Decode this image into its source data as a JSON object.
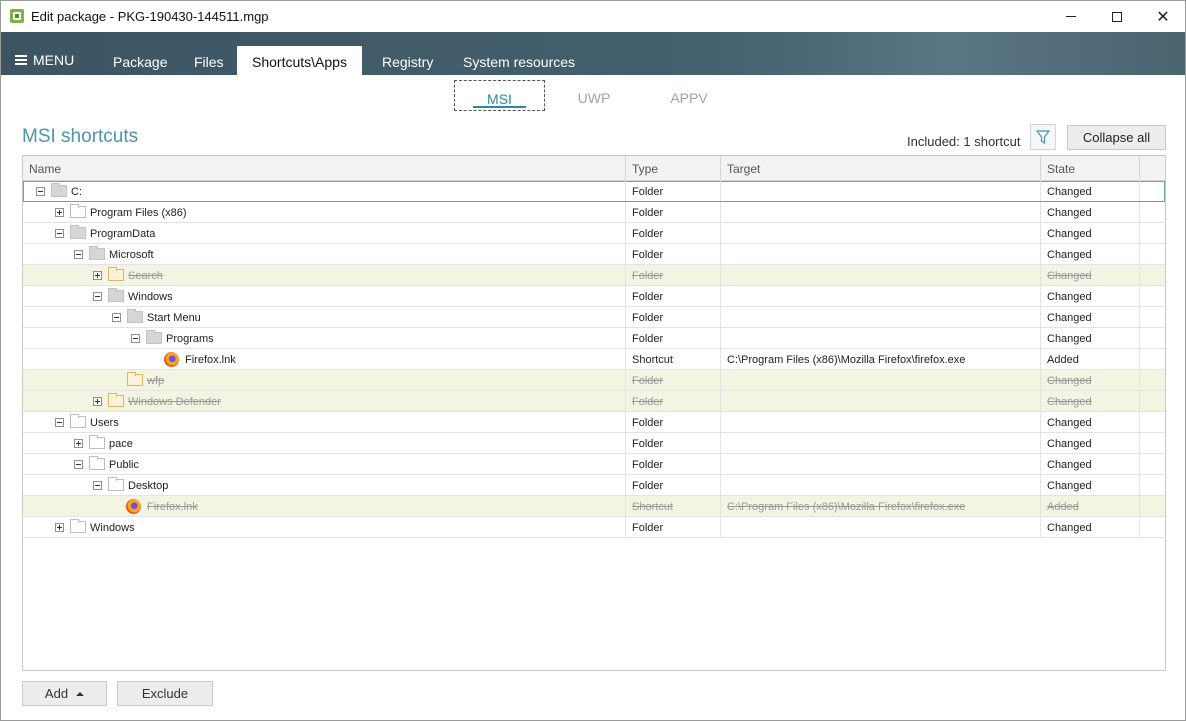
{
  "window": {
    "title": "Edit package - PKG-190430-144511.mgp"
  },
  "menu": {
    "label": "MENU"
  },
  "main_tabs": [
    {
      "label": "Package"
    },
    {
      "label": "Files"
    },
    {
      "label": "Shortcuts\\Apps"
    },
    {
      "label": "Registry"
    },
    {
      "label": "System resources"
    }
  ],
  "sub_tabs": [
    {
      "label": "MSI"
    },
    {
      "label": "UWP"
    },
    {
      "label": "APPV"
    }
  ],
  "section": {
    "title": "MSI shortcuts",
    "included": "Included: 1 shortcut",
    "collapse_label": "Collapse all"
  },
  "columns": [
    "Name",
    "Type",
    "Target",
    "State"
  ],
  "rows": [
    {
      "name": "C:",
      "type": "Folder",
      "target": "",
      "state": "Changed"
    },
    {
      "name": "Program Files (x86)",
      "type": "Folder",
      "target": "",
      "state": "Changed"
    },
    {
      "name": "ProgramData",
      "type": "Folder",
      "target": "",
      "state": "Changed"
    },
    {
      "name": "Microsoft",
      "type": "Folder",
      "target": "",
      "state": "Changed"
    },
    {
      "name": "Search",
      "type": "Folder",
      "target": "",
      "state": "Changed"
    },
    {
      "name": "Windows",
      "type": "Folder",
      "target": "",
      "state": "Changed"
    },
    {
      "name": "Start Menu",
      "type": "Folder",
      "target": "",
      "state": "Changed"
    },
    {
      "name": "Programs",
      "type": "Folder",
      "target": "",
      "state": "Changed"
    },
    {
      "name": "Firefox.lnk",
      "type": "Shortcut",
      "target": "C:\\Program Files (x86)\\Mozilla Firefox\\firefox.exe",
      "state": "Added"
    },
    {
      "name": "wfp",
      "type": "Folder",
      "target": "",
      "state": "Changed"
    },
    {
      "name": "Windows Defender",
      "type": "Folder",
      "target": "",
      "state": "Changed"
    },
    {
      "name": "Users",
      "type": "Folder",
      "target": "",
      "state": "Changed"
    },
    {
      "name": "pace",
      "type": "Folder",
      "target": "",
      "state": "Changed"
    },
    {
      "name": "Public",
      "type": "Folder",
      "target": "",
      "state": "Changed"
    },
    {
      "name": "Desktop",
      "type": "Folder",
      "target": "",
      "state": "Changed"
    },
    {
      "name": "Firefox.lnk",
      "type": "Shortcut",
      "target": "C:\\Program Files (x86)\\Mozilla Firefox\\firefox.exe",
      "state": "Added"
    },
    {
      "name": "Windows",
      "type": "Folder",
      "target": "",
      "state": "Changed"
    }
  ],
  "buttons": {
    "add": "Add",
    "exclude": "Exclude"
  }
}
